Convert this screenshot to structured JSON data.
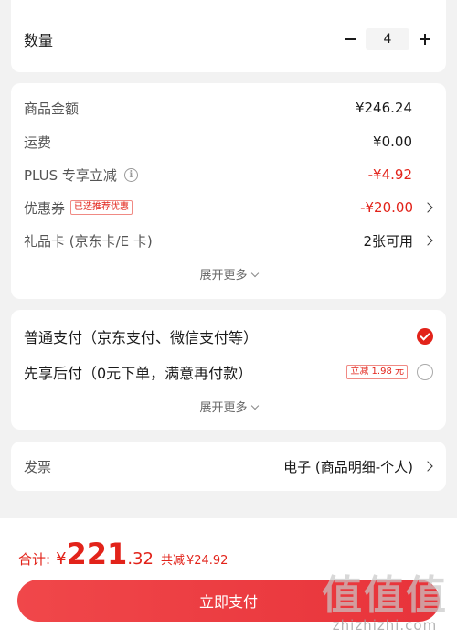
{
  "quantity": {
    "label": "数量",
    "minus": "−",
    "value": "4",
    "plus": "+"
  },
  "price_details": {
    "items": [
      {
        "label": "商品金额",
        "value": "¥246.24"
      },
      {
        "label": "运费",
        "value": "¥0.00"
      },
      {
        "label": "PLUS 专享立减",
        "value": "-¥4.92",
        "info_icon": "info-icon"
      },
      {
        "label": "优惠券",
        "badge": "已选推荐优惠",
        "value": "-¥20.00"
      },
      {
        "label": "礼品卡 (京东卡/E 卡)",
        "value": "2张可用"
      }
    ],
    "expand_label": "展开更多"
  },
  "payment": {
    "options": [
      {
        "label": "普通支付（京东支付、微信支付等）",
        "selected": true
      },
      {
        "label": "先享后付（0元下单，满意再付款）",
        "badge": "立减 1.98 元",
        "selected": false
      }
    ],
    "expand_label": "展开更多"
  },
  "invoice": {
    "label": "发票",
    "value": "电子 (商品明细-个人)"
  },
  "footer": {
    "total_label": "合计:",
    "currency": "¥",
    "total_int": "221",
    "total_dec": ".32",
    "saved_label": "共减",
    "saved_value": "¥24.92",
    "pay_button": "立即支付"
  },
  "watermark": {
    "logo": "值值值",
    "text": "zhizhizhi.com"
  },
  "colors": {
    "accent": "#e2231a",
    "background": "#f2f2f2"
  }
}
